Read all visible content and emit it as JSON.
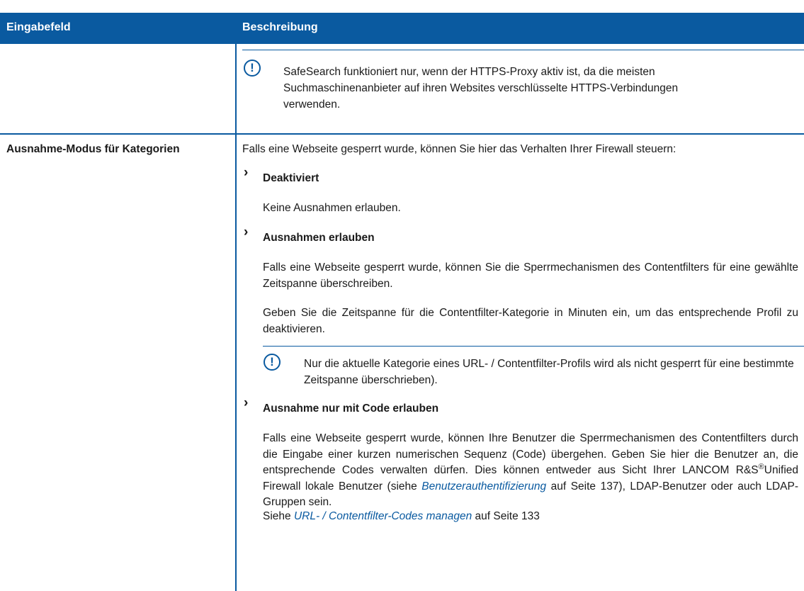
{
  "table": {
    "headers": [
      "Eingabefeld",
      "Beschreibung"
    ]
  },
  "row1": {
    "note": {
      "icon": "exclamation-circle-icon",
      "lines": [
        "SafeSearch funktioniert nur, wenn der HTTPS-Proxy aktiv ist, da die meisten",
        "Suchmaschinenanbieter auf ihren Websites verschlüsselte HTTPS-Verbindungen",
        "verwenden."
      ]
    }
  },
  "row2": {
    "field": "Ausnahme-Modus für Kategorien",
    "intro": "Falls eine Webseite gesperrt wurde, können Sie hier das Verhalten Ihrer Firewall steuern:",
    "options": [
      {
        "title": "Deaktiviert",
        "paragraphs": [
          "Keine Ausnahmen erlauben."
        ]
      },
      {
        "title": "Ausnahmen erlauben",
        "paragraphs": [
          "Falls eine Webseite gesperrt wurde, können Sie die Sperrmechanismen des Contentfilters für eine gewählte Zeitspanne überschreiben.",
          "Geben Sie die Zeitspanne für die Contentfilter-Kategorie in Minuten ein, um das entsprechende Profil zu deaktivieren."
        ],
        "note": "Nur die aktuelle Kategorie eines URL- / Contentfilter-Profils wird als nicht gesperrt für eine bestimmte Zeitspanne überschrieben)."
      },
      {
        "title": "Ausnahme nur mit Code erlauben",
        "paragraph_part1": "Falls eine Webseite gesperrt wurde, können Ihre Benutzer die Sperrmechanismen des Contentfilters durch die Eingabe einer kurzen numerischen Sequenz (Code) übergehen. Geben Sie hier die Benutzer an, die entsprechende Codes verwalten dürfen. Dies können entweder aus Sicht Ihrer LANCOM R&S",
        "registered": "®",
        "paragraph_part2": "Unified Firewall lokale Benutzer (siehe ",
        "link1": "Benutzerauthentifizierung",
        "paragraph_part3": " auf Seite 137), LDAP-Benutzer oder auch LDAP-Gruppen sein.",
        "see_prefix": "Siehe ",
        "link2": "URL- / Contentfilter-Codes managen",
        "see_suffix": " auf Seite 133"
      }
    ]
  },
  "colors": {
    "accent": "#0a5aa0",
    "link": "#0a5aa0"
  }
}
